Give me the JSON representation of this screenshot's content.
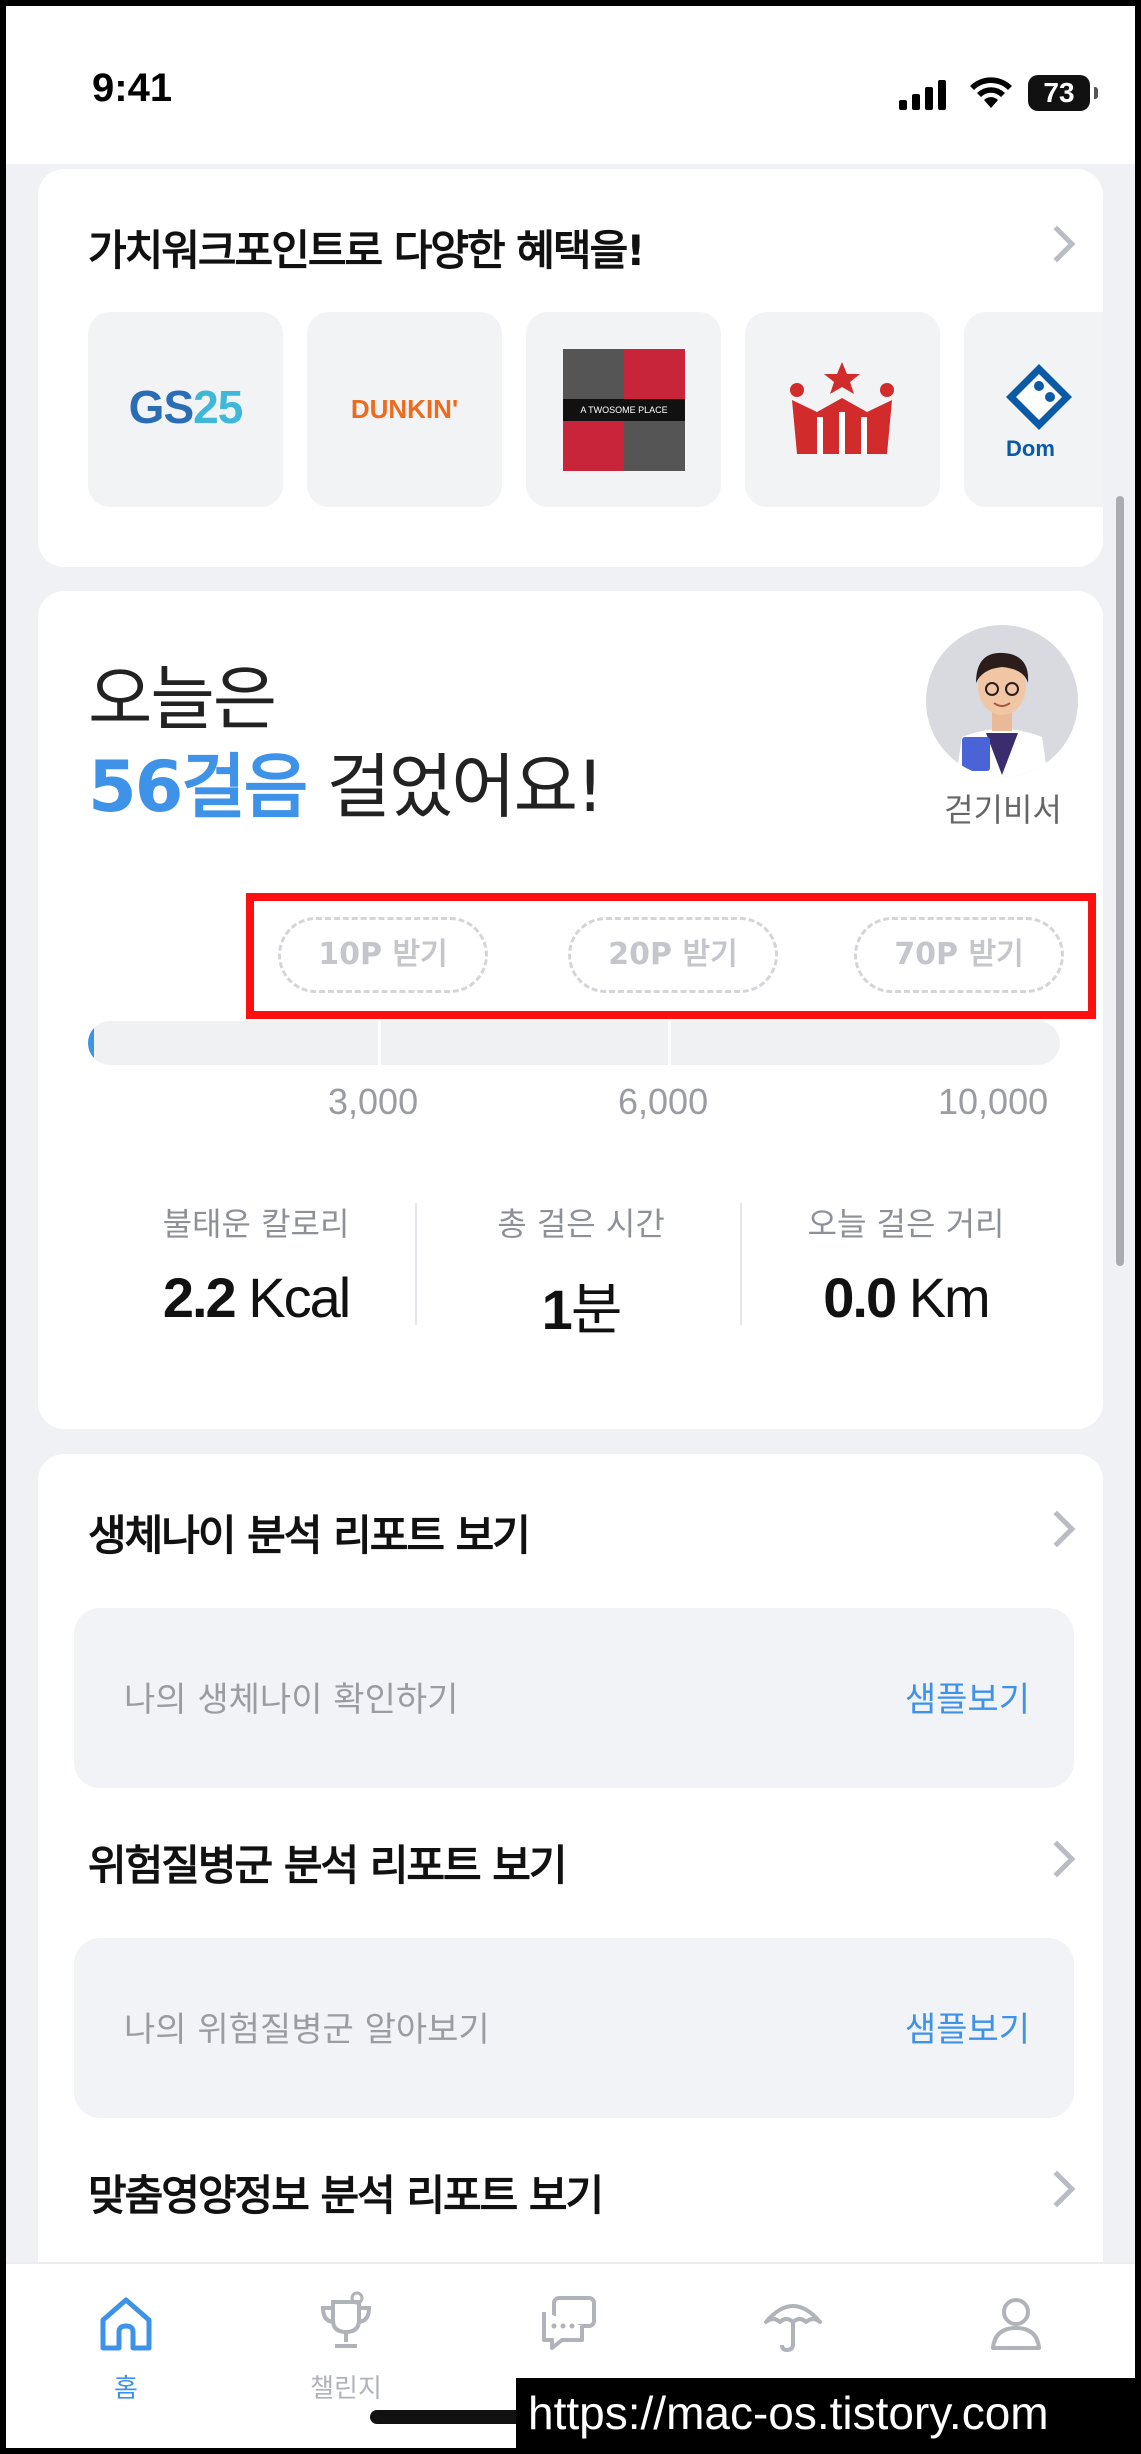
{
  "status_bar": {
    "time": "9:41",
    "battery": "73"
  },
  "benefits": {
    "title": "가치워크포인트로 다양한 혜택을!",
    "brands": {
      "gs25_main": "GS",
      "gs25_sub": "25",
      "dunkin": "DUNKIN'",
      "twosome": "A TWOSOME PLACE",
      "domino": "Dom"
    }
  },
  "steps": {
    "today_label": "오늘은",
    "count": "56걸음",
    "suffix": " 걸었어요!",
    "assistant_label": "걷기비서",
    "rewards": [
      "10P 받기",
      "20P 받기",
      "70P 받기"
    ],
    "progress_fraction": 0.0056,
    "ticks": [
      "3,000",
      "6,000",
      "10,000"
    ],
    "stats": {
      "calories_label": "불태운 칼로리",
      "calories_value": "2.2",
      "calories_unit": "Kcal",
      "time_label": "총 걸은 시간",
      "time_value": "1",
      "time_unit": "분",
      "distance_label": "오늘 걸은 거리",
      "distance_value": "0.0",
      "distance_unit": "Km"
    }
  },
  "reports": [
    {
      "title": "생체나이 분석 리포트 보기",
      "box_text": "나의 생체나이 확인하기",
      "sample": "샘플보기"
    },
    {
      "title": "위험질병군 분석 리포트 보기",
      "box_text": "나의 위험질병군 알아보기",
      "sample": "샘플보기"
    },
    {
      "title": "맞춤영양정보 분석 리포트 보기"
    }
  ],
  "tabs": {
    "home": "홈",
    "challenge": "챌린지"
  },
  "accent_color": "#3e93e8",
  "highlight_color": "#ff1010",
  "watermark": "https://mac-os.tistory.com"
}
